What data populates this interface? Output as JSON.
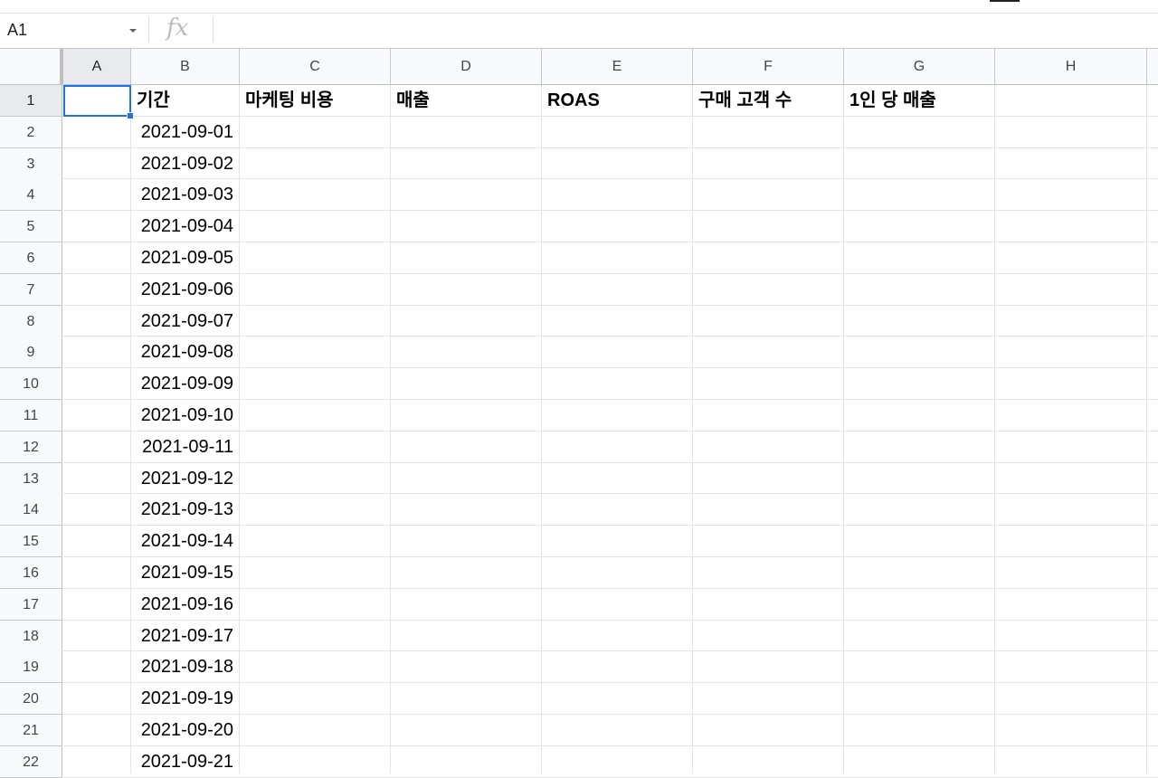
{
  "formula_bar": {
    "name_box": "A1",
    "fx_label": "fx",
    "formula_value": ""
  },
  "columns": [
    "A",
    "B",
    "C",
    "D",
    "E",
    "F",
    "G",
    "H"
  ],
  "rows": [
    "1",
    "2",
    "3",
    "4",
    "5",
    "6",
    "7",
    "8",
    "9",
    "10",
    "11",
    "12",
    "13",
    "14",
    "15",
    "16",
    "17",
    "18",
    "19",
    "20",
    "21",
    "22"
  ],
  "headers": {
    "B": "기간",
    "C": "마케팅 비용",
    "D": "매출",
    "E": "ROAS",
    "F": "구매 고객 수",
    "G": "1인 당 매출"
  },
  "dates": [
    "2021-09-01",
    "2021-09-02",
    "2021-09-03",
    "2021-09-04",
    "2021-09-05",
    "2021-09-06",
    "2021-09-07",
    "2021-09-08",
    "2021-09-09",
    "2021-09-10",
    "2021-09-11",
    "2021-09-12",
    "2021-09-13",
    "2021-09-14",
    "2021-09-15",
    "2021-09-16",
    "2021-09-17",
    "2021-09-18",
    "2021-09-19",
    "2021-09-20",
    "2021-09-21"
  ],
  "colors": {
    "selection": "#1a73e8",
    "header_bg": "#f8f9fa",
    "selected_header_bg": "#e8eaed"
  }
}
